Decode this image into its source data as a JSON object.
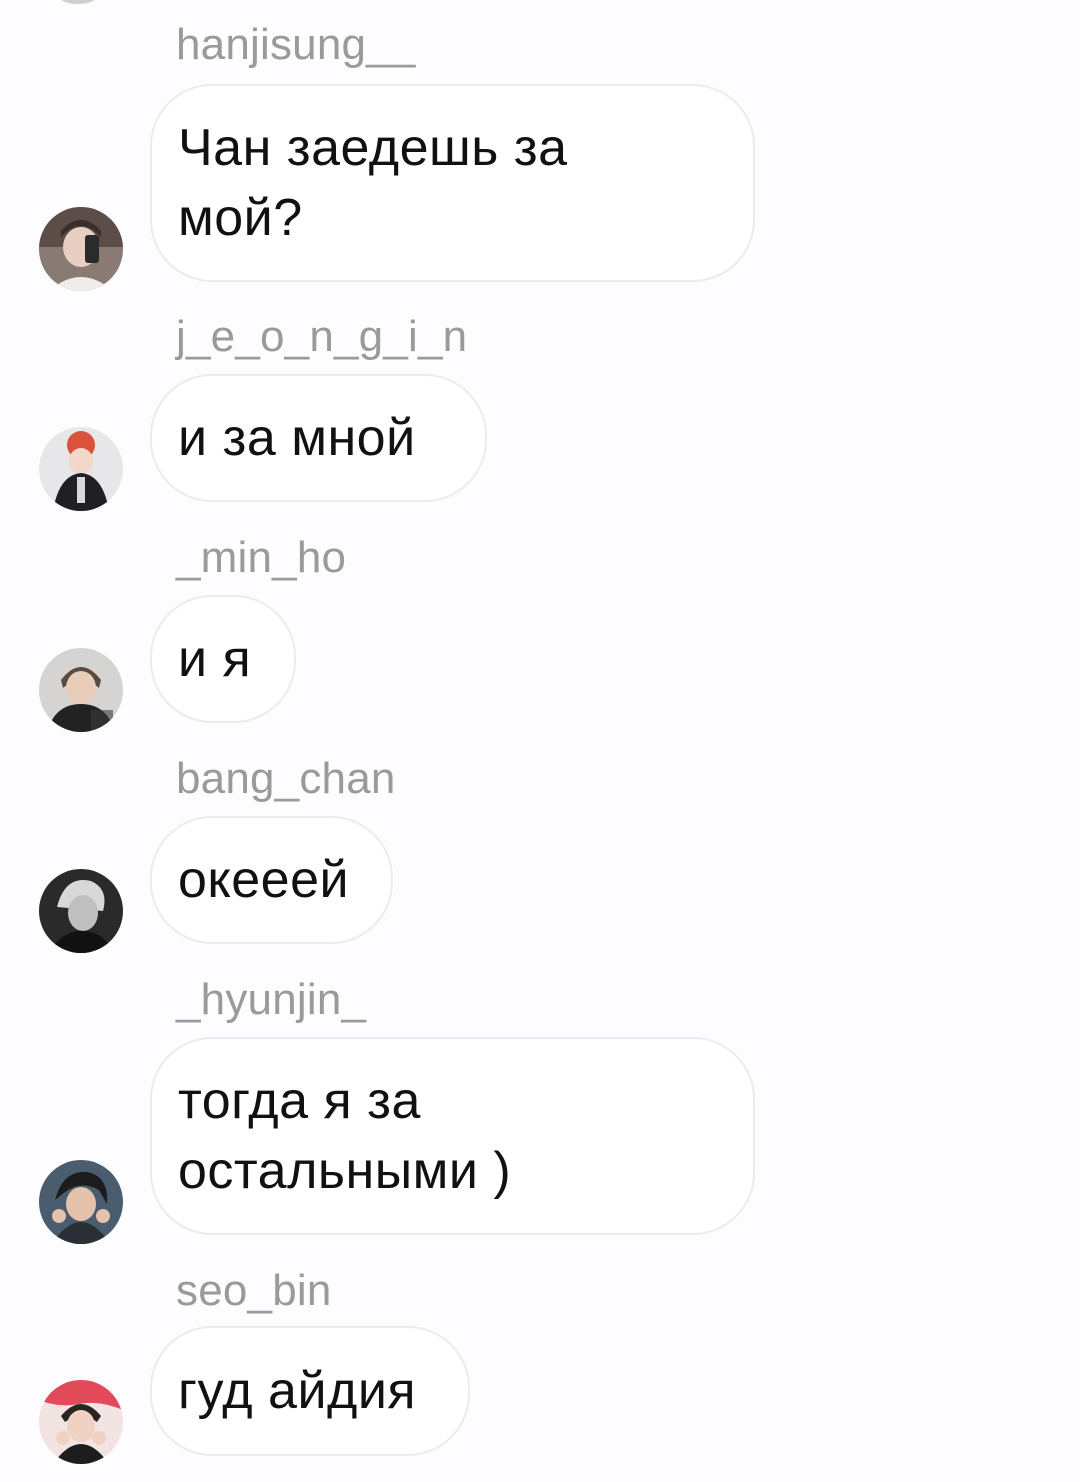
{
  "messages": [
    {
      "username": "hanjisung__",
      "text": "Чан заедешь за\nмой?",
      "avatar": "avatar-photo"
    },
    {
      "username": "j_e_o_n_g_i_n",
      "text": "и за мной",
      "avatar": "avatar-photo"
    },
    {
      "username": "_min_ho",
      "text": "и я",
      "avatar": "avatar-photo"
    },
    {
      "username": "bang_chan",
      "text": "окееей",
      "avatar": "avatar-photo"
    },
    {
      "username": "_hyunjin_",
      "text": "тогда я за\nостальными )",
      "avatar": "avatar-photo"
    },
    {
      "username": "seo_bin",
      "text": "гуд айдия",
      "avatar": "avatar-photo"
    }
  ],
  "colors": {
    "background": "#fdfcfe",
    "bubble": "#ffffff",
    "bubble_border": "#ececec",
    "username": "#9a9a9a",
    "text": "#111111"
  }
}
